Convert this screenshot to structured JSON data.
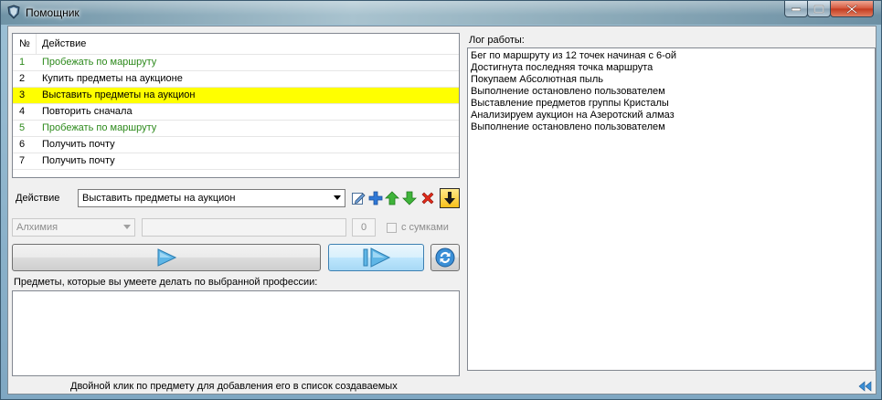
{
  "window": {
    "title": "Помощник"
  },
  "task_list": {
    "header_num": "№",
    "header_action": "Действие",
    "rows": [
      {
        "num": "1",
        "action": "Пробежать по маршруту"
      },
      {
        "num": "2",
        "action": "Купить предметы на аукционе"
      },
      {
        "num": "3",
        "action": "Выставить предметы на аукцион"
      },
      {
        "num": "4",
        "action": "Повторить сначала"
      },
      {
        "num": "5",
        "action": "Пробежать по маршруту"
      },
      {
        "num": "6",
        "action": "Получить почту"
      },
      {
        "num": "7",
        "action": "Получить почту"
      }
    ],
    "selected_index": 2,
    "green_color": "#2d8a1c",
    "selected_color": "#ffff00"
  },
  "action_bar": {
    "label": "Действие",
    "selected": "Выставить предметы на аукцион",
    "icons": [
      "edit-icon",
      "add-icon",
      "move-up-icon",
      "move-down-icon",
      "delete-icon",
      "move-to-bottom-icon"
    ]
  },
  "profession": {
    "selected": "Алхимия",
    "count": "0",
    "with_bags_label": "с сумками",
    "items_label": "Предметы, которые вы умеете делать по выбранной профессии:",
    "hint": "Двойной клик по предмету для добавления его в список создаваемых"
  },
  "log": {
    "label": "Лог работы:",
    "lines": [
      "Бег по маршруту из 12 точек начиная с 6-ой",
      "Достигнута последняя точка маршрута",
      "Покупаем Абсолютная пыль",
      "Выполнение остановлено пользователем",
      "Выставление предметов группы Кристалы",
      "Анализируем аукцион на Азеротский алмаз",
      "Выполнение остановлено пользователем"
    ]
  }
}
